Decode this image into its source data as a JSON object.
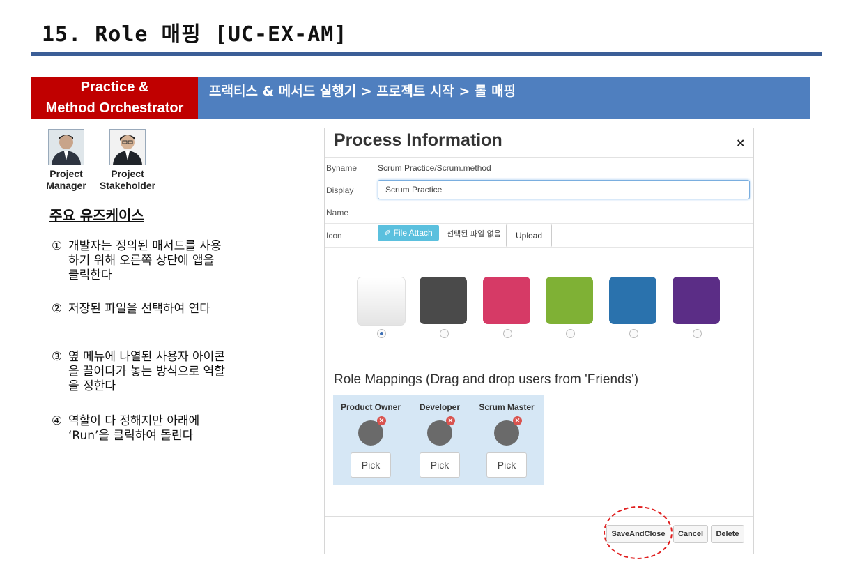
{
  "slide": {
    "title": "15. Role 매핑 [UC-EX-AM]",
    "role_line1": "Practice &",
    "role_line2": "Method Orchestrator",
    "breadcrumb": "프랙티스 & 메서드 실행기 > 프로젝트 시작 > 롤 매핑"
  },
  "personas": [
    {
      "line1": "Project",
      "line2": "Manager"
    },
    {
      "line1": "Project",
      "line2": "Stakeholder"
    }
  ],
  "usecases": {
    "title": "주요 유즈케이스",
    "items": [
      {
        "num": "①",
        "text": "개발자는 정의된 매서드를 사용하기 위해 오른쪽 상단에 앱을 클릭한다"
      },
      {
        "num": "②",
        "text": "저장된 파일을 선택하여 연다"
      },
      {
        "num": "③",
        "text": "옆 메뉴에 나열된 사용자 아이콘을 끌어다가 놓는 방식으로 역할을 정한다"
      },
      {
        "num": "④",
        "text": "역할이 다 정해지만 아래에 ‘Run’을 클릭하여 돌린다"
      }
    ]
  },
  "dialog": {
    "title": "Process Information",
    "close": "×",
    "byname_label": "Byname",
    "byname_value": "Scrum Practice/Scrum.method",
    "display_label": "Display",
    "name_label": "Name",
    "display_value": "Scrum Practice",
    "icon_label": "Icon",
    "file_attach": "✐ File Attach",
    "no_file": "선택된 파일 없음",
    "upload": "Upload",
    "colors": [
      "#f3f3f3",
      "#4a4a4a",
      "#d63a66",
      "#7fb135",
      "#2a72ad",
      "#5b2d86"
    ],
    "selected_color_index": 0,
    "role_mappings_title": "Role Mappings (Drag and drop users from 'Friends')",
    "roles": [
      {
        "label": "Product Owner",
        "pick": "Pick"
      },
      {
        "label": "Developer",
        "pick": "Pick"
      },
      {
        "label": "Scrum Master",
        "pick": "Pick"
      }
    ],
    "remove_mark": "×",
    "buttons": {
      "save_and_close": "SaveAndClose",
      "cancel": "Cancel",
      "delete": "Delete"
    }
  }
}
